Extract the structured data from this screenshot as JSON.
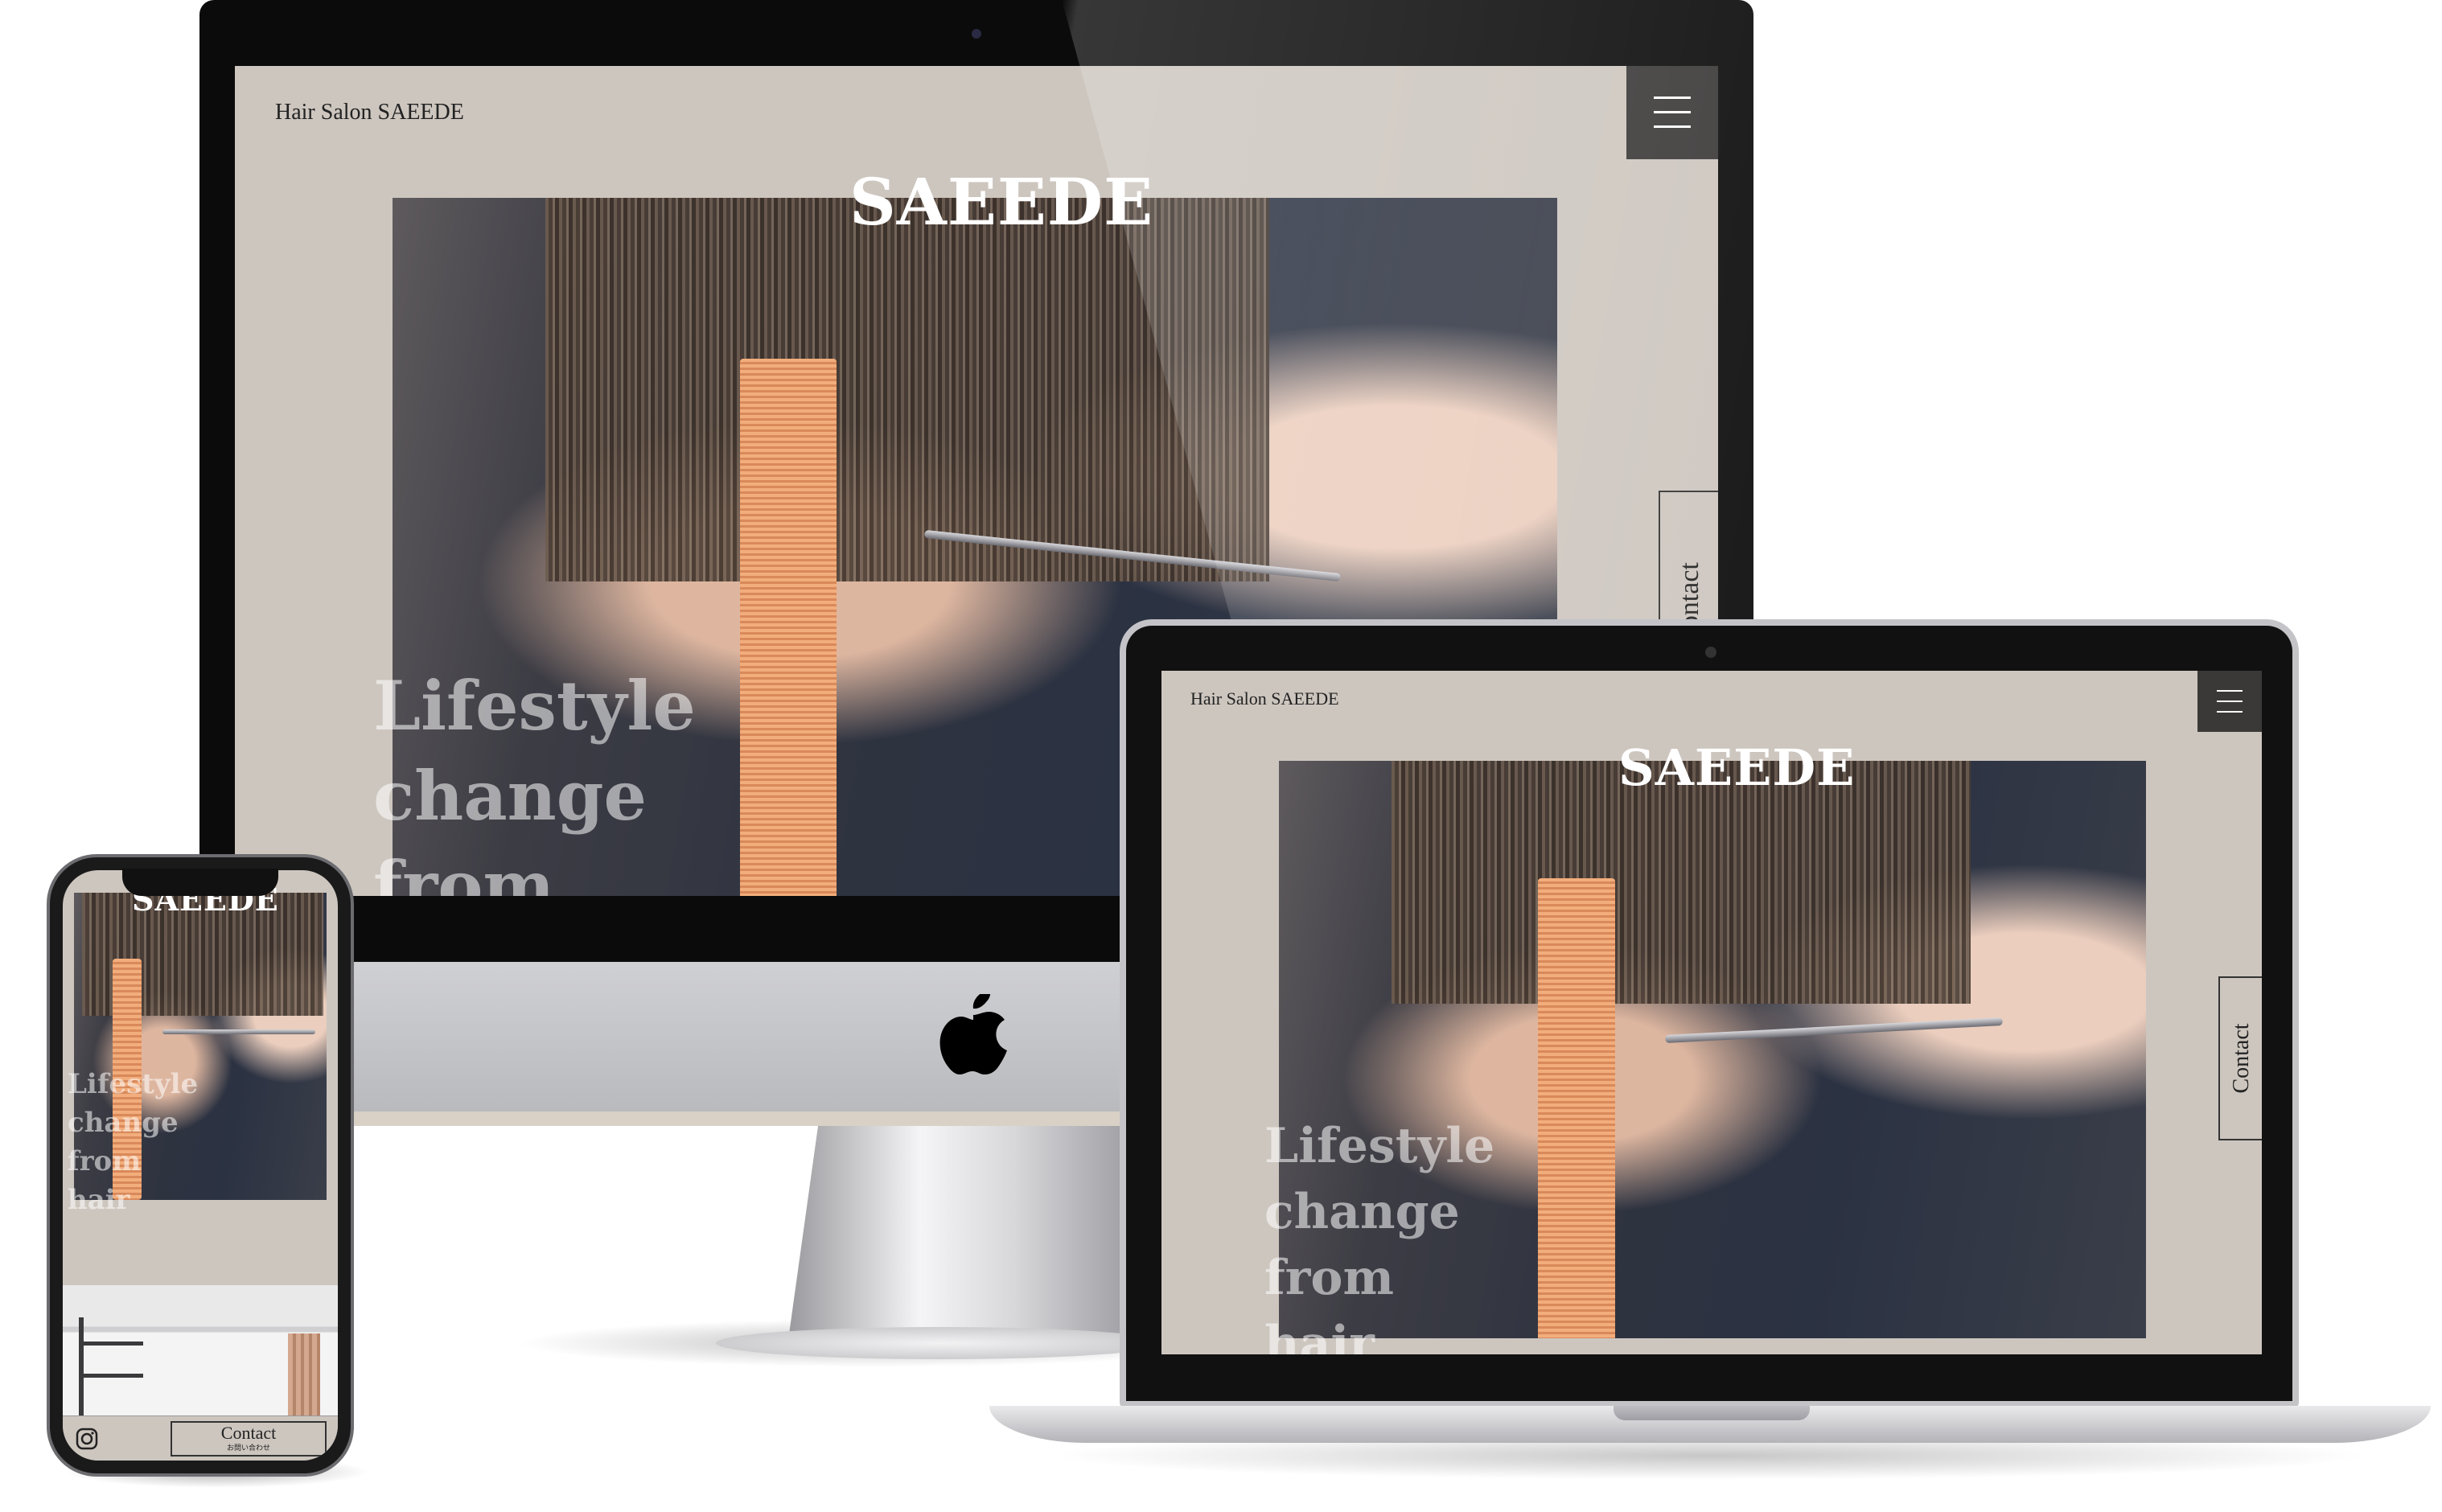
{
  "site": {
    "brand": "Hair Salon SAEEDE",
    "hero_title": "SAEEDE",
    "tagline_lines": [
      "Lifestyle",
      "change",
      "from",
      "hair"
    ],
    "contact_label": "Contact",
    "contact_sub": "お問い合わせ"
  },
  "icons": {
    "menu": "hamburger-icon",
    "instagram": "instagram-icon",
    "apple_logo": "apple-logo-icon"
  },
  "colors": {
    "site_background": "#cdc6bf",
    "menu_button": "#3b3938",
    "text": "#222222"
  }
}
